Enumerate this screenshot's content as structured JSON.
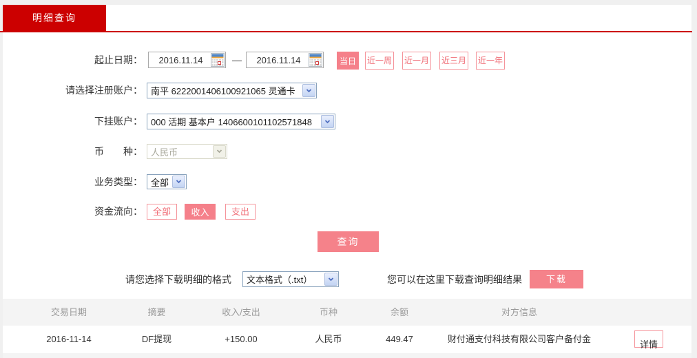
{
  "page": {
    "tab_label": "明细查询"
  },
  "form": {
    "date_range": {
      "label": "起止日期：",
      "start_value": "2016.11.14",
      "end_value": "2016.11.14",
      "separator": "—",
      "quick_buttons": [
        {
          "label": "当日",
          "selected": true
        },
        {
          "label": "近一周",
          "selected": false
        },
        {
          "label": "近一月",
          "selected": false
        },
        {
          "label": "近三月",
          "selected": false
        },
        {
          "label": "近一年",
          "selected": false
        }
      ]
    },
    "register_account": {
      "label": "请选择注册账户：",
      "value": "南平 6222001406100921065 灵通卡"
    },
    "sub_account": {
      "label": "下挂账户：",
      "value": "000 活期 基本户 1406600101102571848"
    },
    "currency": {
      "label": "币　　种：",
      "value": "人民币",
      "disabled": true
    },
    "business_type": {
      "label": "业务类型：",
      "value": "全部"
    },
    "fund_flow": {
      "label": "资金流向：",
      "buttons": [
        {
          "label": "全部",
          "selected": false
        },
        {
          "label": "收入",
          "selected": true
        },
        {
          "label": "支出",
          "selected": false
        }
      ]
    },
    "query_button_label": "查询"
  },
  "download": {
    "format_label": "请您选择下载明细的格式",
    "format_value": "文本格式（.txt）",
    "hint": "您可以在这里下载查询明细结果",
    "button_label": "下载"
  },
  "table": {
    "headers": [
      "交易日期",
      "摘要",
      "收入/支出",
      "币种",
      "余额",
      "对方信息"
    ],
    "rows": [
      {
        "date": "2016-11-14",
        "summary": "DF提现",
        "amount": "+150.00",
        "currency": "人民币",
        "balance": "449.47",
        "counterparty": "财付通支付科技有限公司客户备付金",
        "action_label": "详情"
      }
    ]
  },
  "colors": {
    "brand_red": "#cc0000",
    "accent_pink": "#f5808a",
    "amount_red": "#cc0000",
    "header_gray_bg": "#f4f4f4"
  }
}
